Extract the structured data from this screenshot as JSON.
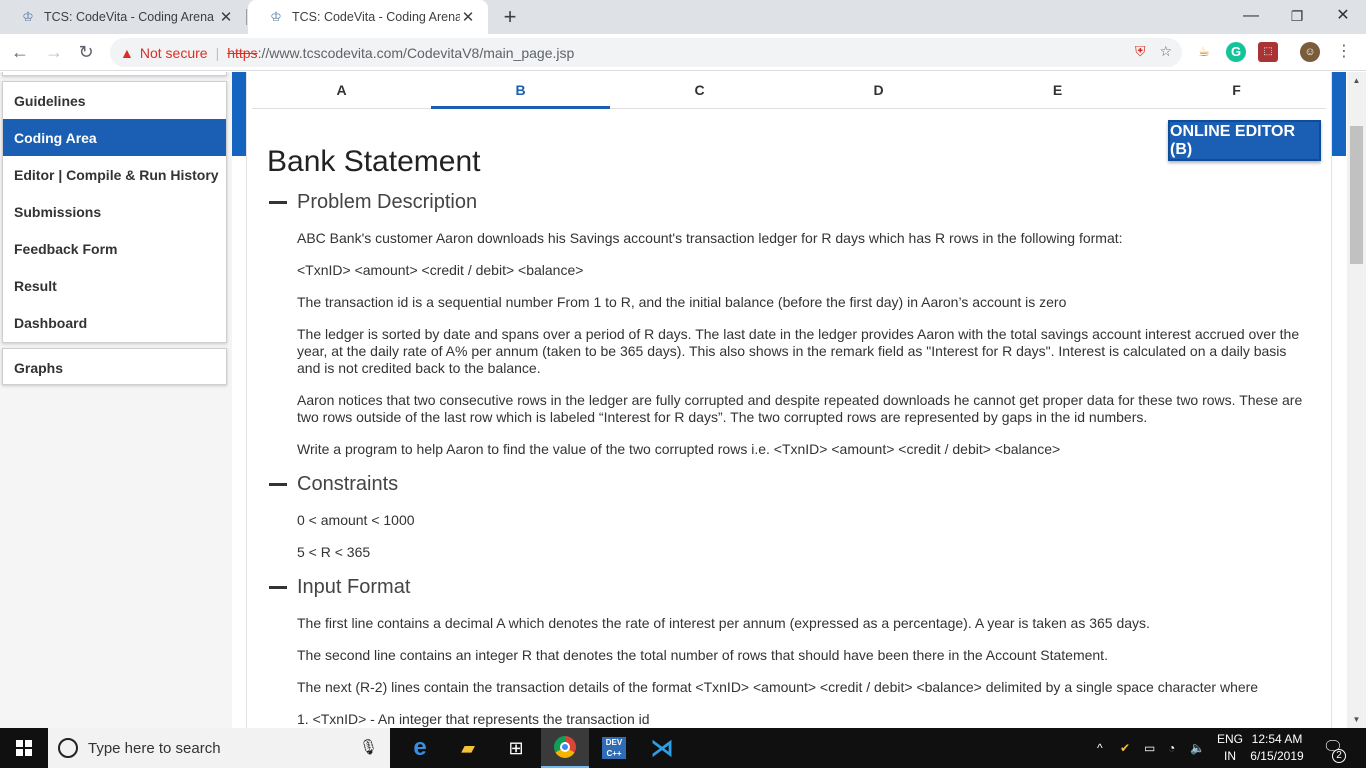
{
  "browser": {
    "tabs": [
      {
        "title": "TCS: CodeVita - Coding Arena",
        "active": false
      },
      {
        "title": "TCS: CodeVita - Coding Arena",
        "active": true
      }
    ],
    "url": {
      "security_label": "Not secure",
      "scheme": "https",
      "rest": "://www.tcscodevita.com/CodevitaV8/main_page.jsp"
    }
  },
  "sidebar": {
    "items": [
      {
        "label": "Guidelines"
      },
      {
        "label": "Coding Area",
        "active": true
      },
      {
        "label": "Editor | Compile & Run History"
      },
      {
        "label": "Submissions"
      },
      {
        "label": "Feedback Form"
      },
      {
        "label": "Result"
      },
      {
        "label": "Dashboard"
      }
    ],
    "graphs_label": "Graphs"
  },
  "problem_tabs": [
    "A",
    "B",
    "C",
    "D",
    "E",
    "F"
  ],
  "active_problem_tab": "B",
  "online_editor_label": "ONLINE EDITOR (B)",
  "problem": {
    "title": "Bank Statement",
    "description_heading": "Problem Description",
    "description": [
      "ABC Bank's customer Aaron downloads his Savings account's transaction ledger for R days which has R rows in the following format:",
      "<TxnID> <amount> <credit / debit> <balance>",
      "The transaction id is a sequential number From 1 to R, and the initial balance (before the first day) in Aaron’s account is zero",
      "The ledger is sorted by date and spans over a period of R days. The last date in the ledger provides Aaron with the total savings account interest accrued over the year, at the daily rate of A% per annum (taken to be 365 days). This also shows in the remark field as \"Interest for R days\". Interest is calculated on a daily basis and is not credited back to the balance.",
      "Aaron notices that two consecutive rows in the ledger are fully corrupted and despite repeated downloads he cannot get proper data for these two rows. These are two rows outside of the last row which is labeled “Interest for R days”. The two corrupted rows are represented by gaps in the id numbers.",
      "Write a program to help Aaron to find the value of the two corrupted rows i.e. <TxnID> <amount> <credit / debit> <balance>"
    ],
    "constraints_heading": "Constraints",
    "constraints": [
      "0 < amount < 1000",
      "5 < R < 365"
    ],
    "input_heading": "Input Format",
    "input": [
      "The first line contains a decimal A which denotes the rate of interest per annum (expressed as a percentage). A year is taken as 365 days.",
      "The second line contains an integer R that denotes the total number of rows that should have been there in the Account Statement.",
      "The next (R-2) lines contain the transaction details of the format <TxnID> <amount> <credit / debit> <balance> delimited by a single space character where",
      "1. <TxnID> - An integer that represents the transaction id"
    ]
  },
  "taskbar": {
    "search_placeholder": "Type here to search",
    "lang": [
      "ENG",
      "IN"
    ],
    "time": "12:54 AM",
    "date": "6/15/2019",
    "notification_count": "2"
  },
  "colors": {
    "accent": "#1a5fb4",
    "warning": "#d93025"
  },
  "icons": [
    "back-arrow-icon",
    "forward-arrow-icon",
    "reload-icon",
    "warning-icon",
    "star-icon",
    "search-icon",
    "mic-icon",
    "windows-logo-icon"
  ]
}
